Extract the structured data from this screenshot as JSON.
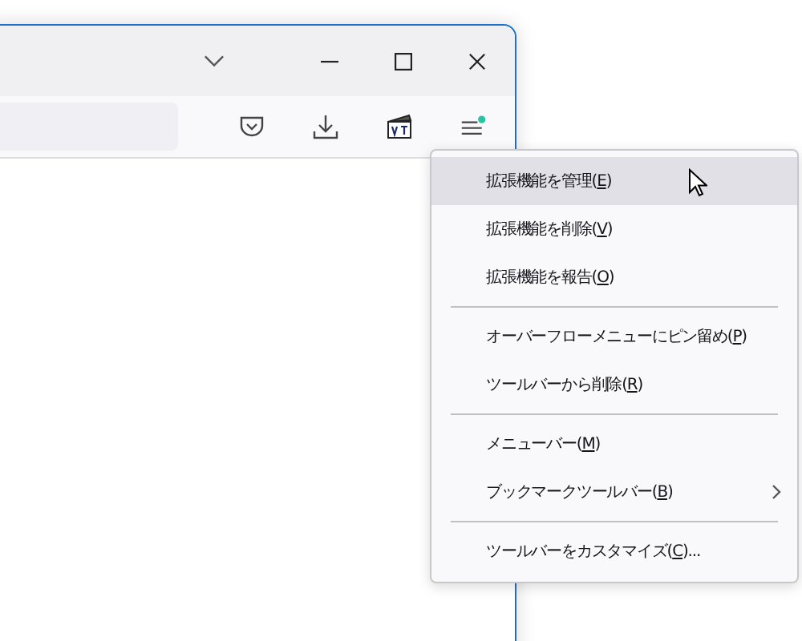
{
  "menu": {
    "items": [
      {
        "kind": "item",
        "before": "拡張機能を管理(",
        "key": "E",
        "after": ")",
        "selected": true,
        "submenu": false
      },
      {
        "kind": "item",
        "before": "拡張機能を削除(",
        "key": "V",
        "after": ")",
        "selected": false,
        "submenu": false
      },
      {
        "kind": "item",
        "before": "拡張機能を報告(",
        "key": "O",
        "after": ")",
        "selected": false,
        "submenu": false
      },
      {
        "kind": "separator"
      },
      {
        "kind": "item",
        "before": "オーバーフローメニューにピン留め(",
        "key": "P",
        "after": ")",
        "selected": false,
        "submenu": false
      },
      {
        "kind": "item",
        "before": "ツールバーから削除(",
        "key": "R",
        "after": ")",
        "selected": false,
        "submenu": false
      },
      {
        "kind": "separator"
      },
      {
        "kind": "item",
        "before": "メニューバー(",
        "key": "M",
        "after": ")",
        "selected": false,
        "submenu": false
      },
      {
        "kind": "item",
        "before": "ブックマークツールバー(",
        "key": "B",
        "after": ")",
        "selected": false,
        "submenu": true
      },
      {
        "kind": "separator"
      },
      {
        "kind": "item",
        "before": "ツールバーをカスタマイズ(",
        "key": "C",
        "after": ")...",
        "selected": false,
        "submenu": false
      }
    ]
  }
}
